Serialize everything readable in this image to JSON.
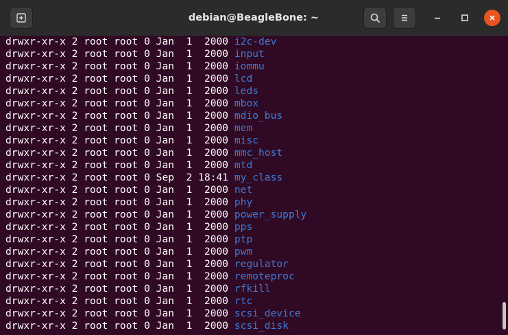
{
  "window": {
    "title": "debian@BeagleBone: ~",
    "accent_close": "#e95420",
    "terminal_background": "#300a24",
    "directory_color": "#3e7bd8"
  },
  "icons": {
    "new_tab": "new-tab-icon",
    "search": "search-icon",
    "menu": "hamburger-menu-icon",
    "minimize": "minimize-icon",
    "maximize": "maximize-icon",
    "close": "close-icon"
  },
  "lines": [
    {
      "perm": "drwxr-xr-x 2 root root 0 Jan  1  2000 ",
      "name": "i2c-dev"
    },
    {
      "perm": "drwxr-xr-x 2 root root 0 Jan  1  2000 ",
      "name": "input"
    },
    {
      "perm": "drwxr-xr-x 2 root root 0 Jan  1  2000 ",
      "name": "iommu"
    },
    {
      "perm": "drwxr-xr-x 2 root root 0 Jan  1  2000 ",
      "name": "lcd"
    },
    {
      "perm": "drwxr-xr-x 2 root root 0 Jan  1  2000 ",
      "name": "leds"
    },
    {
      "perm": "drwxr-xr-x 2 root root 0 Jan  1  2000 ",
      "name": "mbox"
    },
    {
      "perm": "drwxr-xr-x 2 root root 0 Jan  1  2000 ",
      "name": "mdio_bus"
    },
    {
      "perm": "drwxr-xr-x 2 root root 0 Jan  1  2000 ",
      "name": "mem"
    },
    {
      "perm": "drwxr-xr-x 2 root root 0 Jan  1  2000 ",
      "name": "misc"
    },
    {
      "perm": "drwxr-xr-x 2 root root 0 Jan  1  2000 ",
      "name": "mmc_host"
    },
    {
      "perm": "drwxr-xr-x 2 root root 0 Jan  1  2000 ",
      "name": "mtd"
    },
    {
      "perm": "drwxr-xr-x 2 root root 0 Sep  2 18:41 ",
      "name": "my_class"
    },
    {
      "perm": "drwxr-xr-x 2 root root 0 Jan  1  2000 ",
      "name": "net"
    },
    {
      "perm": "drwxr-xr-x 2 root root 0 Jan  1  2000 ",
      "name": "phy"
    },
    {
      "perm": "drwxr-xr-x 2 root root 0 Jan  1  2000 ",
      "name": "power_supply"
    },
    {
      "perm": "drwxr-xr-x 2 root root 0 Jan  1  2000 ",
      "name": "pps"
    },
    {
      "perm": "drwxr-xr-x 2 root root 0 Jan  1  2000 ",
      "name": "ptp"
    },
    {
      "perm": "drwxr-xr-x 2 root root 0 Jan  1  2000 ",
      "name": "pwm"
    },
    {
      "perm": "drwxr-xr-x 2 root root 0 Jan  1  2000 ",
      "name": "regulator"
    },
    {
      "perm": "drwxr-xr-x 2 root root 0 Jan  1  2000 ",
      "name": "remoteproc"
    },
    {
      "perm": "drwxr-xr-x 2 root root 0 Jan  1  2000 ",
      "name": "rfkill"
    },
    {
      "perm": "drwxr-xr-x 2 root root 0 Jan  1  2000 ",
      "name": "rtc"
    },
    {
      "perm": "drwxr-xr-x 2 root root 0 Jan  1  2000 ",
      "name": "scsi_device"
    },
    {
      "perm": "drwxr-xr-x 2 root root 0 Jan  1  2000 ",
      "name": "scsi_disk"
    }
  ]
}
